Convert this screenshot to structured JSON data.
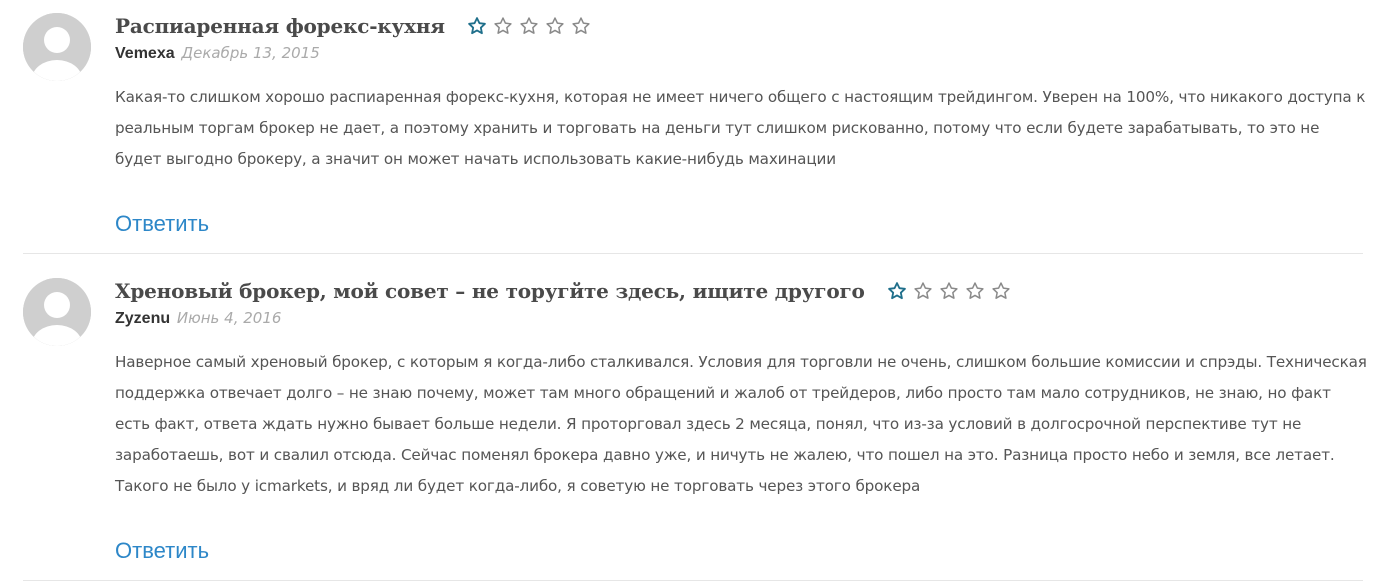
{
  "comments": [
    {
      "title": "Распиаренная форекс-кухня",
      "author": "Vemexa",
      "date": "Декабрь 13, 2015",
      "rating": 1,
      "rating_max": 5,
      "text": "Какая-то слишком хорошо распиаренная форекс-кухня, которая не имеет ничего общего с настоящим трейдингом. Уверен на 100%, что никакого доступа к реальным торгам брокер не дает, а поэтому хранить и торговать на деньги тут слишком рискованно, потому что если будете зарабатывать, то это не будет выгодно брокеру, а значит он может начать использовать какие-нибудь махинации",
      "reply_label": "Ответить"
    },
    {
      "title": "Хреновый брокер, мой совет – не торугйте здесь, ищите другого",
      "author": "Zyzenu",
      "date": "Июнь 4, 2016",
      "rating": 1,
      "rating_max": 5,
      "text": "Наверное самый хреновый брокер, с которым я когда-либо сталкивался. Условия для торговли не очень, слишком большие комиссии и спрэды. Техническая поддержка отвечает долго – не знаю почему, может там много обращений и жалоб от трейдеров, либо просто там мало сотрудников, не знаю, но факт есть факт, ответа ждать нужно бывает больше недели. Я проторговал здесь 2 месяца, понял, что из-за условий в долгосрочной перспективе тут не заработаешь, вот и свалил отсюда. Сейчас поменял брокера давно уже, и ничуть не жалею, что пошел на это. Разница просто небо и земля, все летает. Такого не было у icmarkets, и вряд ли будет когда-либо, я советую не торговать через этого брокера",
      "reply_label": "Ответить"
    }
  ],
  "colors": {
    "star_filled": "#1f6f8b",
    "star_empty": "#8a8a8a",
    "reply_link": "#2d87c8",
    "avatar_bg": "#cfcfcf"
  },
  "icons": {
    "avatar": "default-user-avatar-icon",
    "star_filled": "star-outline-blue-icon",
    "star_empty": "star-outline-gray-icon"
  }
}
